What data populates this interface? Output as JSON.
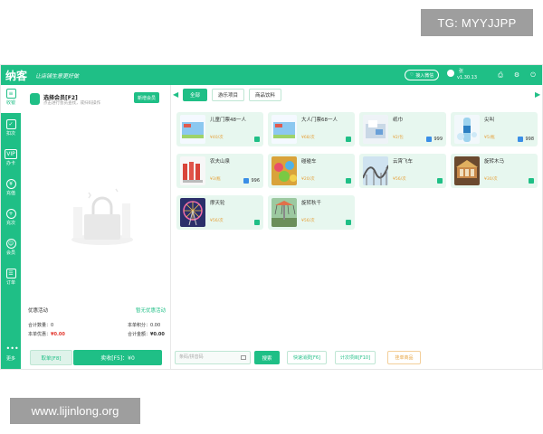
{
  "watermarks": {
    "top": "TG: MYYJJPP",
    "bottom": "www.lijinlong.org"
  },
  "topbar": {
    "logo": "纳客",
    "slogan": "让店铺生意更好做",
    "connect_label": "接入微信",
    "user_name": "张",
    "version": "v1.30.13",
    "icons": [
      "printer-icon",
      "gear-icon",
      "power-icon"
    ]
  },
  "sidebar": {
    "items": [
      {
        "label": "收银",
        "icon": "cashier-icon"
      },
      {
        "label": "扣次",
        "icon": "deduct-icon"
      },
      {
        "label": "办卡",
        "icon": "vip-card-icon"
      },
      {
        "label": "充值",
        "icon": "recharge-icon"
      },
      {
        "label": "充次",
        "icon": "charge-times-icon"
      },
      {
        "label": "会员",
        "icon": "member-icon"
      },
      {
        "label": "订单",
        "icon": "order-icon"
      },
      {
        "label": "更多",
        "icon": "more-icon"
      }
    ],
    "active": "收银"
  },
  "member_panel": {
    "title": "选择会员[F2]",
    "subtitle": "点击进行会员查找，或扫码操作",
    "new_member_label": "新增会员",
    "promo_label": "优惠活动",
    "promo_link": "暂无优惠活动",
    "stats": {
      "total_qty_label": "合计数量：",
      "total_qty": "0",
      "points_label": "本单积分：",
      "points": "0.00",
      "discount_label": "本单优惠：",
      "discount": "¥0.00",
      "amount_label": "合计金额：",
      "amount": "¥0.00"
    },
    "cancel_label": "取单[F8]",
    "sell_label": "卖收[F5]：¥0"
  },
  "tabs": [
    "全部",
    "游乐项目",
    "商品饮料"
  ],
  "active_tab": "全部",
  "products": [
    {
      "name": "儿童门票48一人",
      "price": "¥40/次",
      "stock": "",
      "thumb": "ticket"
    },
    {
      "name": "大人门票68一人",
      "price": "¥68/次",
      "stock": "",
      "thumb": "ticket"
    },
    {
      "name": "纸巾",
      "price": "¥2/包",
      "stock": "999",
      "thumb": "tissue"
    },
    {
      "name": "尖叫",
      "price": "¥5/瓶",
      "stock": "998",
      "thumb": "drink"
    },
    {
      "name": "农夫山泉",
      "price": "¥3/瓶",
      "stock": "996",
      "thumb": "water"
    },
    {
      "name": "碰碰车",
      "price": "¥20/次",
      "stock": "",
      "thumb": "bumper"
    },
    {
      "name": "云霄飞车",
      "price": "¥56/次",
      "stock": "",
      "thumb": "coaster"
    },
    {
      "name": "旋转木马",
      "price": "¥30/次",
      "stock": "",
      "thumb": "carousel"
    },
    {
      "name": "摩天轮",
      "price": "¥56/次",
      "stock": "",
      "thumb": "ferris"
    },
    {
      "name": "旋转秋千",
      "price": "¥56/次",
      "stock": "",
      "thumb": "swing"
    }
  ],
  "bottom_bar": {
    "search_placeholder": "条码/拼音码",
    "search_button": "搜索",
    "quick_consume": "快速消费[F6]",
    "timed_items": "计次项目[F10]",
    "hang_items": "挂单商品"
  },
  "colors": {
    "accent": "#1fbf86",
    "price": "#e6a23c",
    "red": "#e2382e"
  }
}
